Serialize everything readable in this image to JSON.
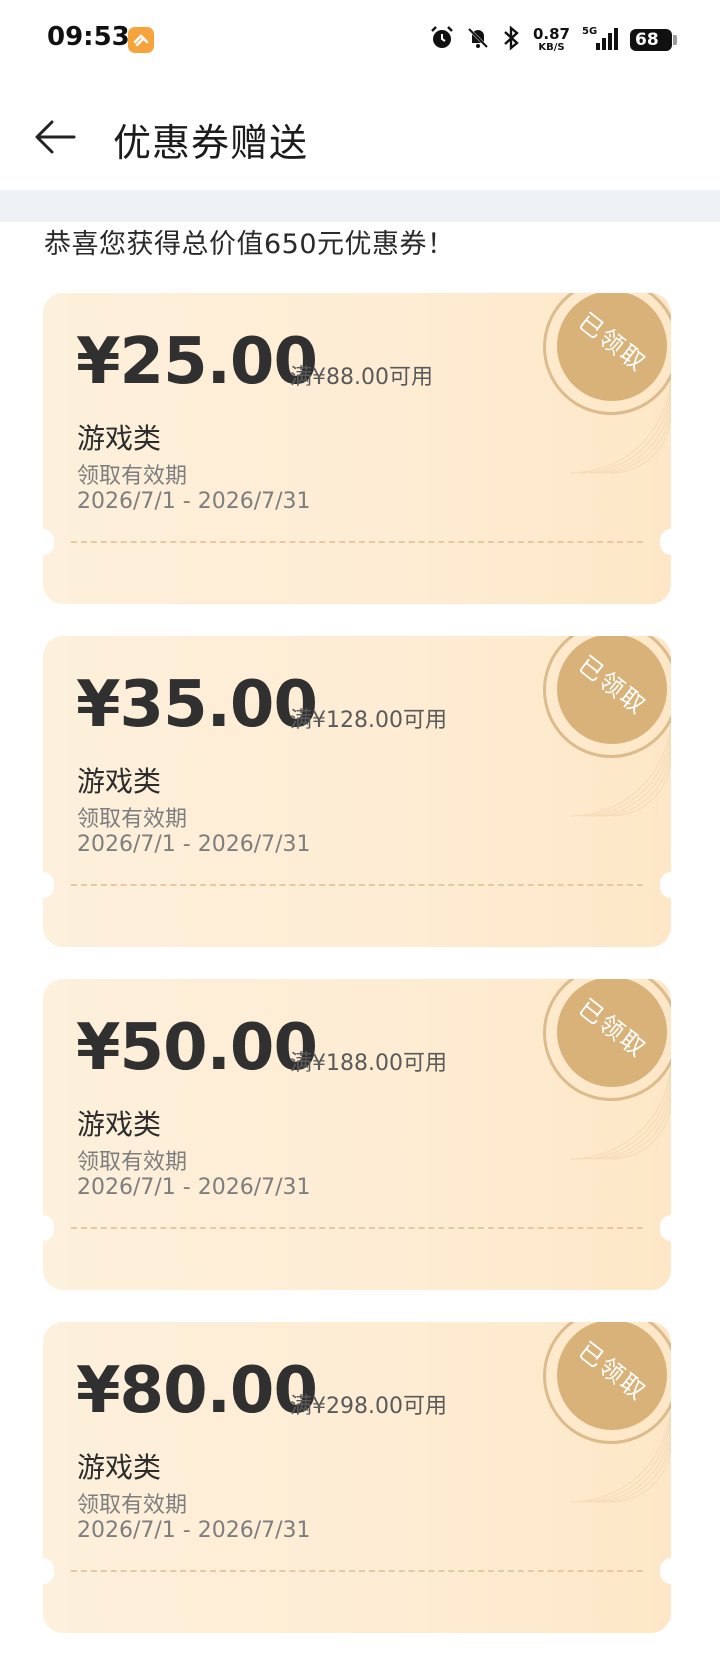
{
  "status_bar": {
    "time": "09:53",
    "net_speed_value": "0.87",
    "net_speed_unit": "KB/S",
    "signal_label": "5G",
    "battery": "68"
  },
  "header": {
    "title": "优惠券赠送"
  },
  "congrats_text": "恭喜您获得总价值650元优惠券！",
  "coupons": [
    {
      "amount": "¥25.00",
      "threshold": "满¥88.00可用",
      "category": "游戏类",
      "validity_label": "领取有效期",
      "validity_range": "2026/7/1 - 2026/7/31",
      "stamp": "已领取"
    },
    {
      "amount": "¥35.00",
      "threshold": "满¥128.00可用",
      "category": "游戏类",
      "validity_label": "领取有效期",
      "validity_range": "2026/7/1 - 2026/7/31",
      "stamp": "已领取"
    },
    {
      "amount": "¥50.00",
      "threshold": "满¥188.00可用",
      "category": "游戏类",
      "validity_label": "领取有效期",
      "validity_range": "2026/7/1 - 2026/7/31",
      "stamp": "已领取"
    },
    {
      "amount": "¥80.00",
      "threshold": "满¥298.00可用",
      "category": "游戏类",
      "validity_label": "领取有效期",
      "validity_range": "2026/7/1 - 2026/7/31",
      "stamp": "已领取"
    }
  ],
  "colors": {
    "coupon_bg": "#fdecd2",
    "stamp": "#d9b27a",
    "app_badge": "#f7a33b"
  }
}
